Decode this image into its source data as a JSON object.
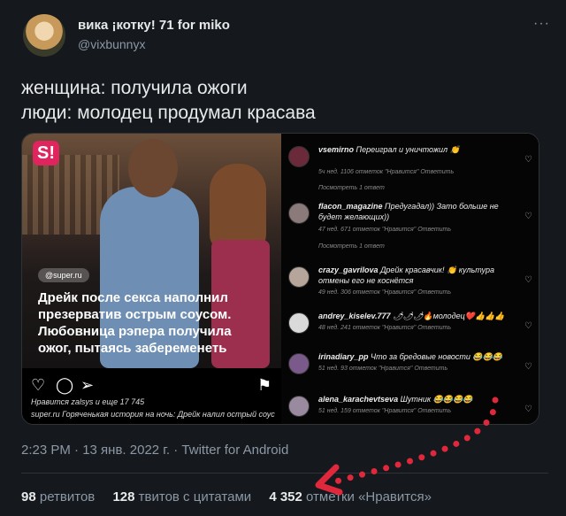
{
  "author": {
    "display_name": "вика ¡котку! 71 for miko",
    "handle": "@vixbunnyx",
    "more_glyph": "···"
  },
  "tweet": {
    "text": "женщина: получила ожоги\nлюди: молодец продумал красава"
  },
  "media": {
    "brand_letter": "S!",
    "source": "@super.ru",
    "headline": "Дрейк после секса наполнил\nпрезерватив острым соусом.\nЛюбовница рэпера получила\nожог, пытаясь забеременеть",
    "likes_line": "Нравится zalsys и еще 17 745",
    "caption_line": "super.ru Горяченькая история на ночь: Дрейк налил острый соус в",
    "action_icons": [
      "heart-icon",
      "comment-icon",
      "share-icon",
      "bookmark-icon"
    ],
    "comments": [
      {
        "user": "vsemirno",
        "text": "Переиграл и уничтожил 👏",
        "meta": "5ч нед.   1106 отметок \"Нравится\"   Ответить",
        "replies": "Посмотреть 1 ответ"
      },
      {
        "user": "flacon_magazine",
        "text": "Предугадал)) Зато больше не будет желающих))",
        "meta": "47 нед.   671 отметок \"Нравится\"   Ответить",
        "replies": "Посмотреть 1 ответ"
      },
      {
        "user": "crazy_gavrilova",
        "text": "Дрейк красавчик! 👏 культура отмены его не коснётся",
        "meta": "49 нед.   306 отметок \"Нравится\"   Ответить",
        "replies": ""
      },
      {
        "user": "andrey_kiselev.777",
        "text": "🌶🌶🌶🔥молодец❤️👍👍👍",
        "meta": "48 нед.   241 отметок \"Нравится\"   Ответить",
        "replies": ""
      },
      {
        "user": "irinadiary_pp",
        "text": "Что за бредовые новости 😂😂😂",
        "meta": "51 нед.   93 отметок \"Нравится\"   Ответить",
        "replies": ""
      },
      {
        "user": "alena_karachevtseva",
        "text": "Шутник 😂😂😂😂",
        "meta": "51 нед.   159 отметок \"Нравится\"   Ответить",
        "replies": ""
      }
    ]
  },
  "timestamp": "2:23 PM · 13 янв. 2022 г. · Twitter for Android",
  "stats": {
    "retweets_count": "98",
    "retweets_label": "ретвитов",
    "quotes_count": "128",
    "quotes_label": "твитов с цитатами",
    "likes_count": "4 352",
    "likes_label": "отметки «Нравится»"
  },
  "colors": {
    "background": "#15181c",
    "arrow": "#e0283c",
    "brand": "#e0245e"
  }
}
